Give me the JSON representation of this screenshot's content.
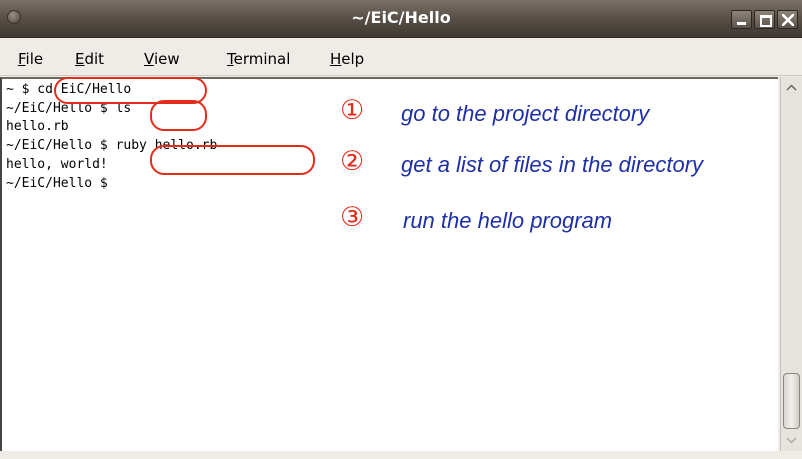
{
  "window": {
    "title": "~/EiC/Hello"
  },
  "menu": [
    {
      "accel": "F",
      "rest": "ile"
    },
    {
      "accel": "E",
      "rest": "dit"
    },
    {
      "accel": "V",
      "rest": "iew"
    },
    {
      "accel": "T",
      "rest": "erminal"
    },
    {
      "accel": "H",
      "rest": "elp"
    }
  ],
  "terminal": {
    "lines": [
      "~ $ cd EiC/Hello",
      "~/EiC/Hello $ ls",
      "hello.rb",
      "~/EiC/Hello $ ruby hello.rb",
      "hello, world!",
      "~/EiC/Hello $"
    ]
  },
  "annotations": [
    {
      "num": "①",
      "text": "go to the project directory"
    },
    {
      "num": "②",
      "text": "get a list of files in the directory"
    },
    {
      "num": "③",
      "text": "run the hello program"
    }
  ],
  "colors": {
    "annotation_number": "#e32d1a",
    "annotation_text": "#1e2fa8",
    "highlight_oval": "#e32d1a"
  },
  "icons": {
    "window_menu": "window-orb-icon",
    "minimize": "minimize-icon",
    "maximize": "maximize-icon",
    "close": "close-icon",
    "scroll_up": "chevron-up-icon",
    "scroll_down": "chevron-down-icon"
  }
}
